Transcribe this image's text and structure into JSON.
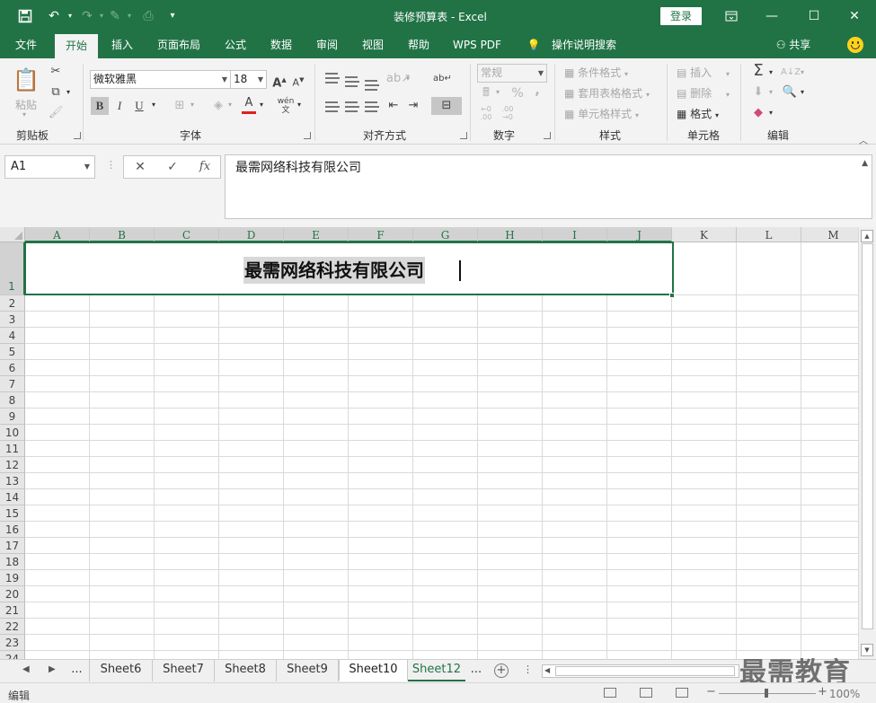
{
  "window": {
    "title": "装修预算表  -  Excel",
    "login_label": "登录"
  },
  "qat": {
    "save_icon": "save-icon",
    "undo_icon": "undo-icon",
    "redo_icon": "redo-icon",
    "customize_icon": "customize-qat-icon"
  },
  "ribbon_tabs": [
    {
      "label": "文件"
    },
    {
      "label": "开始",
      "active": true
    },
    {
      "label": "插入"
    },
    {
      "label": "页面布局"
    },
    {
      "label": "公式"
    },
    {
      "label": "数据"
    },
    {
      "label": "审阅"
    },
    {
      "label": "视图"
    },
    {
      "label": "帮助"
    },
    {
      "label": "WPS PDF"
    },
    {
      "label": "操作说明搜索"
    }
  ],
  "share_label": "共享",
  "groups": {
    "clipboard": {
      "label": "剪贴板",
      "paste": "粘贴"
    },
    "font": {
      "label": "字体",
      "name": "微软雅黑",
      "size": "18",
      "bold": "B",
      "italic": "I",
      "underline": "U",
      "font_color": "#e02020"
    },
    "alignment": {
      "label": "对齐方式"
    },
    "number": {
      "label": "数字",
      "format": "常规",
      "percent": "%",
      "comma": ","
    },
    "styles": {
      "label": "样式",
      "conditional": "条件格式",
      "table": "套用表格格式",
      "cell": "单元格样式"
    },
    "cells": {
      "label": "单元格",
      "insert": "插入",
      "delete": "删除",
      "format": "格式"
    },
    "editing": {
      "label": "编辑"
    }
  },
  "formula_bar": {
    "name_box": "A1",
    "content": "最需网络科技有限公司"
  },
  "grid": {
    "columns": [
      "A",
      "B",
      "C",
      "D",
      "E",
      "F",
      "G",
      "H",
      "I",
      "J",
      "K",
      "L",
      "M"
    ],
    "rows": [
      "1",
      "2",
      "3",
      "4",
      "5",
      "6",
      "7",
      "8",
      "9",
      "10",
      "11",
      "12",
      "13",
      "14",
      "15",
      "16",
      "17",
      "18",
      "19",
      "20",
      "21",
      "22",
      "23",
      "24"
    ],
    "merged_cell_text": "最需网络科技有限公司",
    "accent": "#217346"
  },
  "sheets": {
    "ellipsis": "...",
    "tabs": [
      {
        "label": "Sheet6"
      },
      {
        "label": "Sheet7"
      },
      {
        "label": "Sheet8"
      },
      {
        "label": "Sheet9"
      },
      {
        "label": "Sheet10",
        "active": true
      },
      {
        "label": "Sheet12",
        "green": true
      }
    ],
    "more": "..."
  },
  "watermark": "最需教育",
  "status": {
    "mode": "编辑",
    "zoom": "100%"
  }
}
